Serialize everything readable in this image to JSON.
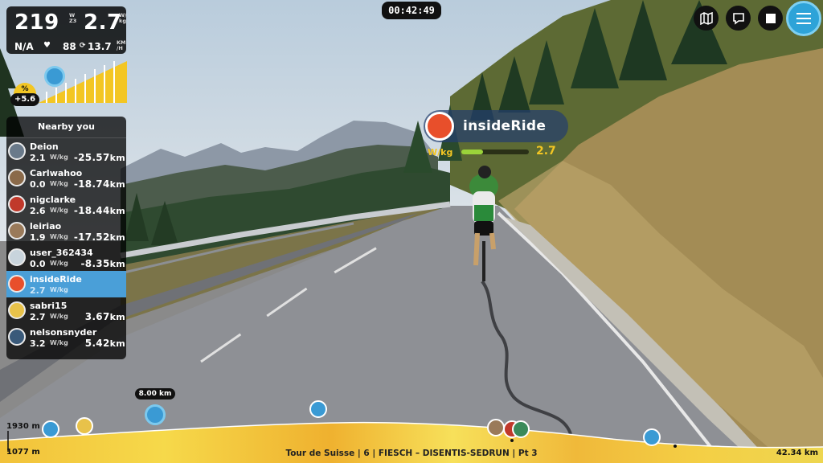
{
  "hud": {
    "power": "219",
    "power_units": [
      "W",
      "Z3"
    ],
    "wkg": "2.7",
    "wkg_units": [
      "W/",
      "kg"
    ],
    "heart_rate": "N/A",
    "cadence": "88",
    "speed": "13.7",
    "speed_units": [
      "KM",
      "/H"
    ]
  },
  "gradient": {
    "label": "%",
    "value": "+5.6"
  },
  "timer": "00:42:49",
  "nearby": {
    "title": "Nearby you",
    "wkg_unit": "W/kg",
    "riders": [
      {
        "name": "Deion",
        "wkg": "2.1",
        "gap": "-25.57",
        "unit": "km"
      },
      {
        "name": "Carlwahoo",
        "wkg": "0.0",
        "gap": "-18.74",
        "unit": "km"
      },
      {
        "name": "nigclarke",
        "wkg": "2.6",
        "gap": "-18.44",
        "unit": "km"
      },
      {
        "name": "leiriao",
        "wkg": "1.9",
        "gap": "-17.52",
        "unit": "km"
      },
      {
        "name": "user_362434",
        "wkg": "0.0",
        "gap": "-8.35",
        "unit": "km"
      },
      {
        "name": "insideRide",
        "wkg": "2.7",
        "gap": "",
        "unit": ""
      },
      {
        "name": "sabri15",
        "wkg": "2.7",
        "gap": "3.67",
        "unit": "km"
      },
      {
        "name": "nelsonsnyder",
        "wkg": "3.2",
        "gap": "5.42",
        "unit": "km"
      }
    ]
  },
  "rider_tag": {
    "name": "insideRide",
    "wkg_label": "W/kg",
    "wkg": "2.7",
    "wkg_level": 0.32
  },
  "profile": {
    "max_elev": "1930 m",
    "min_elev": "1077 m",
    "distance_flag": "8.00 km",
    "stage": "Tour de Suisse | 6 | FIESCH – DISENTIS-SEDRUN | Pt 3",
    "total": "42.34 km"
  },
  "controls": [
    "map-icon",
    "chat-icon",
    "stop-icon",
    "menu-icon"
  ],
  "colors": {
    "accent": "#2ea3d8",
    "highlight": "#f3c623",
    "self": "#4a9fd8"
  }
}
